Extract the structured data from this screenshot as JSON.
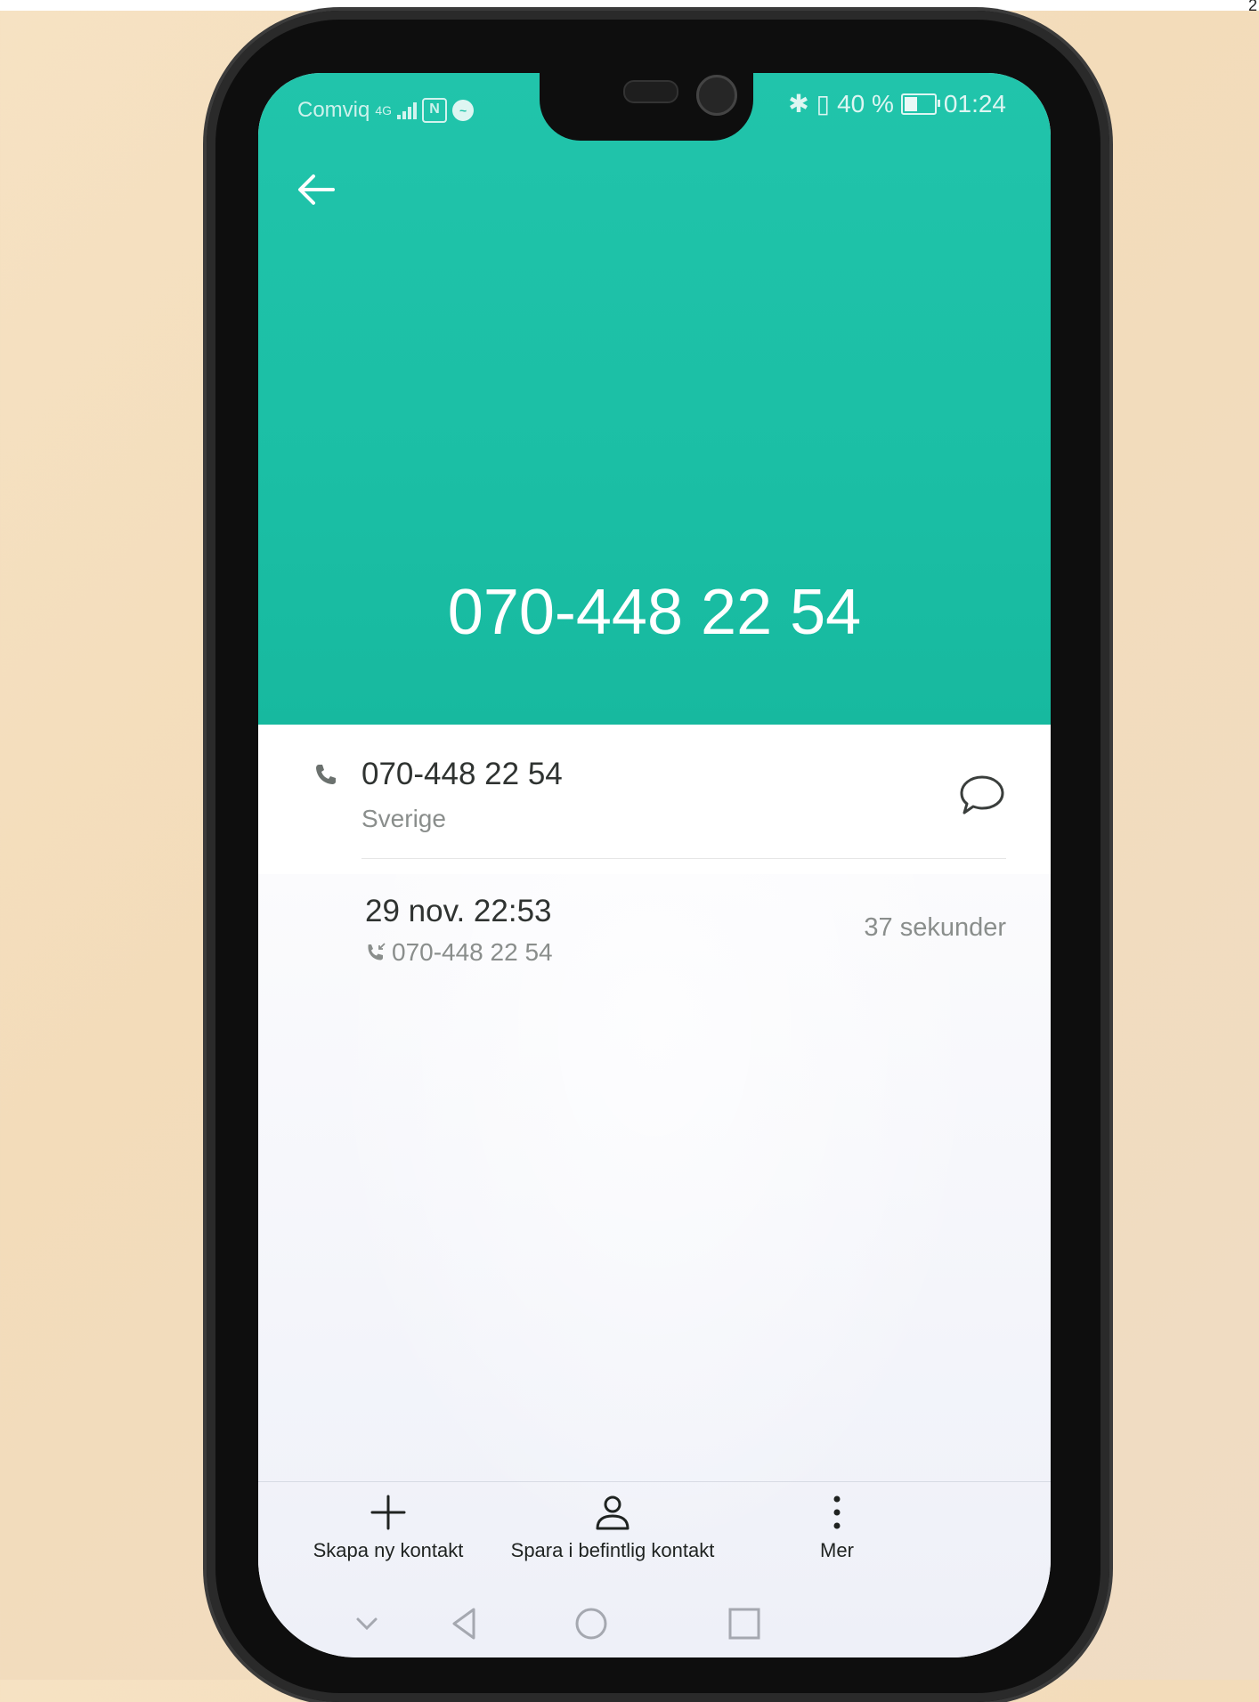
{
  "corner_mark": "2",
  "status_bar": {
    "carrier": "Comviq",
    "network_type": "4G",
    "battery": "40 %",
    "time": "01:24",
    "icons": [
      "signal-icon",
      "nfc-icon",
      "messenger-icon",
      "bluetooth-icon",
      "vibrate-icon",
      "battery-icon"
    ]
  },
  "header": {
    "back_icon": "back-arrow-icon",
    "number": "070-448 22 54"
  },
  "details": {
    "number": "070-448 22 54",
    "country": "Sverige",
    "phone_icon": "phone-icon",
    "message_icon": "message-icon"
  },
  "call_log": {
    "datetime": "29 nov. 22:53",
    "number": "070-448 22 54",
    "duration": "37 sekunder",
    "call_icon": "incoming-call-icon"
  },
  "actions": {
    "create": "Skapa ny kontakt",
    "save_existing": "Spara i befintlig kontakt",
    "more": "Mer"
  },
  "colors": {
    "header": "#1fc2a8",
    "text_primary": "#2f3331",
    "text_secondary": "#8a8e8c"
  }
}
